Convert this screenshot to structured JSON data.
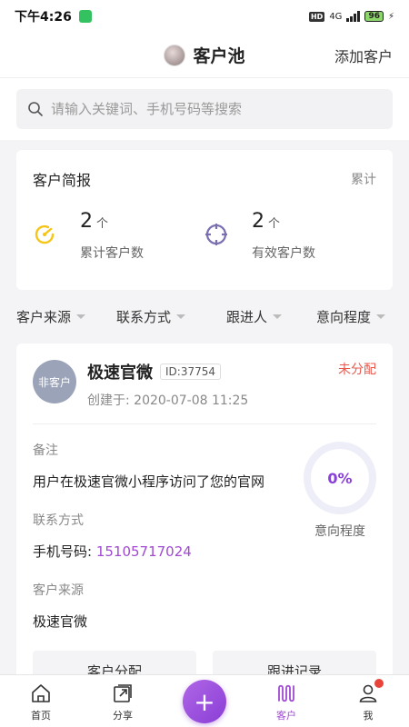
{
  "status_bar": {
    "time": "下午4:26",
    "hd": "HD",
    "network": "4G",
    "battery": "96"
  },
  "nav": {
    "title": "客户池",
    "action": "添加客户"
  },
  "search": {
    "placeholder": "请输入关键词、手机号码等搜索"
  },
  "summary": {
    "title": "客户简报",
    "link": "累计",
    "stats": [
      {
        "value": "2",
        "unit": "个",
        "label": "累计客户数",
        "icon": "gauge-icon"
      },
      {
        "value": "2",
        "unit": "个",
        "label": "有效客户数",
        "icon": "target-icon"
      }
    ]
  },
  "filters": [
    "客户来源",
    "联系方式",
    "跟进人",
    "意向程度"
  ],
  "customer": {
    "avatar_text": "非客户",
    "name": "极速官微",
    "id": "ID:37754",
    "created": "创建于: 2020-07-08 11:25",
    "status": "未分配",
    "note_label": "备注",
    "note": "用户在极速官微小程序访问了您的官网",
    "contact_label": "联系方式",
    "phone_prefix": "手机号码: ",
    "phone": "15105717024",
    "source_label": "客户来源",
    "source": "极速官微",
    "intent_value": "0%",
    "intent_label": "意向程度",
    "actions": [
      "客户分配",
      "跟进记录"
    ]
  },
  "tabs": [
    {
      "label": "首页",
      "icon": "home-icon"
    },
    {
      "label": "分享",
      "icon": "share-icon"
    },
    {
      "label": "",
      "icon": "plus-icon"
    },
    {
      "label": "客户",
      "icon": "customers-icon"
    },
    {
      "label": "我",
      "icon": "user-icon"
    }
  ],
  "colors": {
    "accent": "#a049d2",
    "status_red": "#e8584d",
    "gauge_yellow": "#f5c518",
    "target_purple": "#7a6fb0"
  }
}
